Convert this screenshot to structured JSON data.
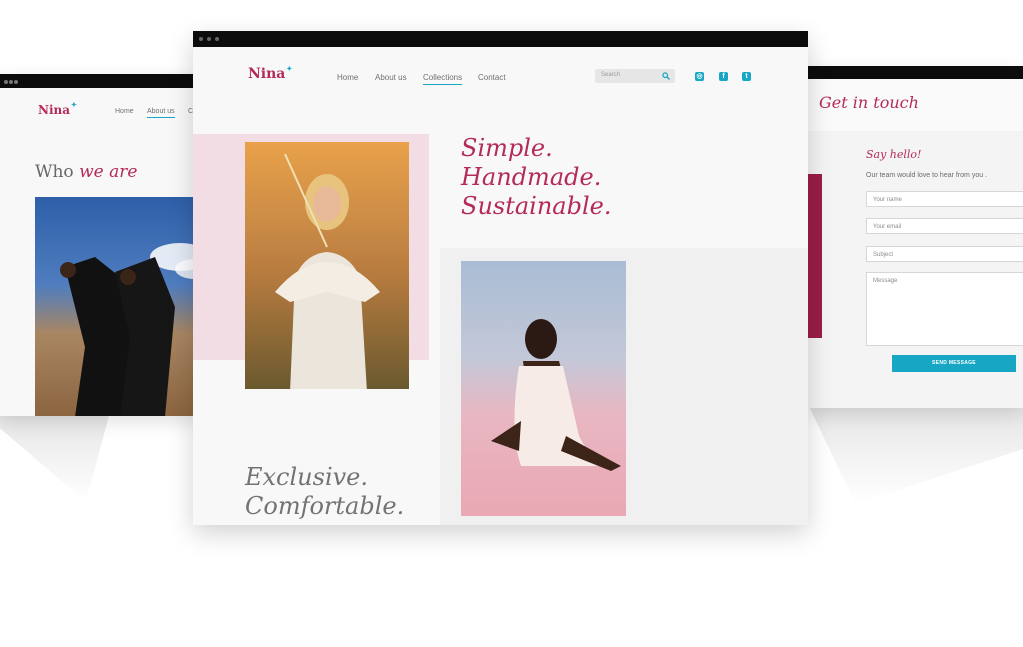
{
  "colors": {
    "brand": "#b42a5b",
    "accent": "#17a6c3",
    "pink_block": "#f2dde4",
    "crimson_block": "#9b1d4a",
    "text_grey": "#707070"
  },
  "left_window": {
    "brand": "Nina",
    "nav": [
      "Home",
      "About us",
      "C"
    ],
    "active_nav": "About us",
    "heading_plain": "Who",
    "heading_accent": "we are"
  },
  "main_window": {
    "brand": "Nina",
    "nav": [
      "Home",
      "About us",
      "Collections",
      "Contact"
    ],
    "active_nav": "Collections",
    "search_placeholder": "Search",
    "social_icons": [
      "instagram-icon",
      "facebook-icon",
      "twitter-icon"
    ],
    "tagline_lines": [
      "Simple.",
      "Handmade.",
      "Sustainable."
    ],
    "secondary_lines": [
      "Exclusive.",
      "Comfortable."
    ]
  },
  "right_window": {
    "heading": "Get in touch",
    "form_title": "Say hello!",
    "form_intro": "Our team would love to hear from you .",
    "fields": {
      "name": "Your name",
      "email": "Your email",
      "subject": "Subject",
      "message": "Message"
    },
    "submit_label": "SEND MESSAGE"
  }
}
